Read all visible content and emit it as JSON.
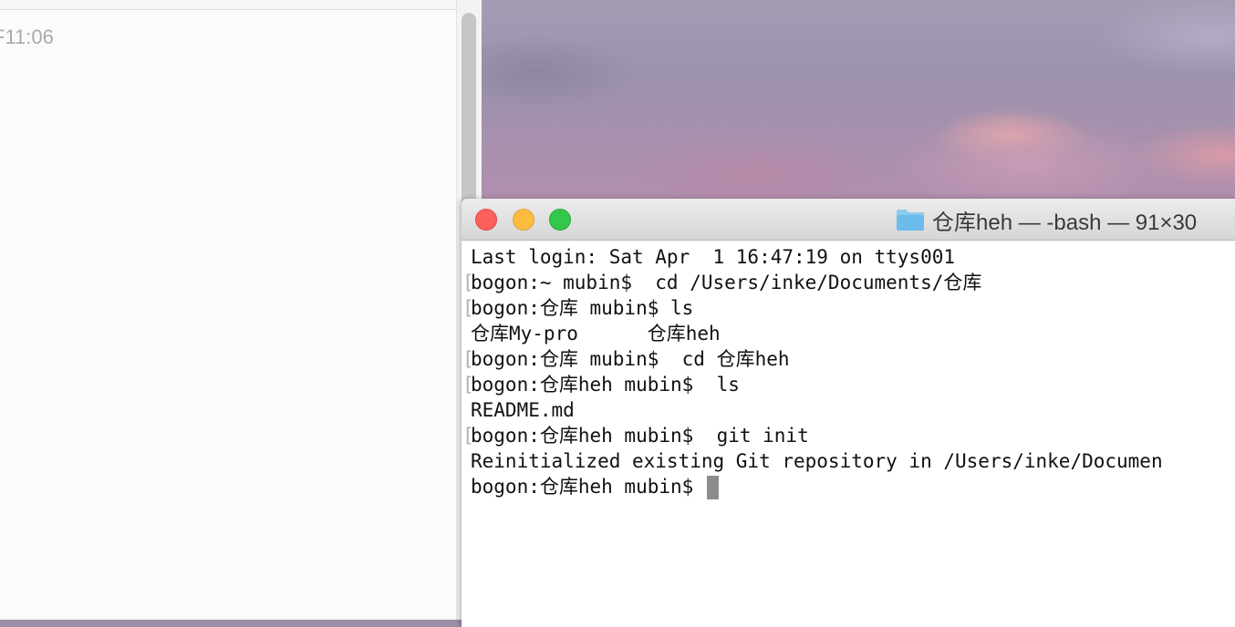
{
  "notes": {
    "time_fragment": "F11:06"
  },
  "terminal": {
    "title": "仓库heh — -bash — 91×30",
    "lines": [
      {
        "text": "Last login: Sat Apr  1 16:47:19 on ttys001",
        "marked": false
      },
      {
        "text": "bogon:~ mubin$  cd /Users/inke/Documents/仓库",
        "marked": true
      },
      {
        "text": "bogon:仓库 mubin$ ls",
        "marked": true
      },
      {
        "text": "仓库My-pro      仓库heh",
        "marked": false
      },
      {
        "text": "bogon:仓库 mubin$  cd 仓库heh",
        "marked": true
      },
      {
        "text": "bogon:仓库heh mubin$  ls",
        "marked": true
      },
      {
        "text": "README.md",
        "marked": false
      },
      {
        "text": "bogon:仓库heh mubin$  git init",
        "marked": true
      },
      {
        "text": "Reinitialized existing Git repository in /Users/inke/Documen",
        "marked": false
      },
      {
        "text": "bogon:仓库heh mubin$ ",
        "marked": false
      }
    ],
    "icons": {
      "folder": "folder-icon",
      "close": "close-button",
      "minimize": "minimize-button",
      "zoom": "zoom-button"
    },
    "colors": {
      "close": "#fc605b",
      "minimize": "#fdbc40",
      "zoom": "#34c84a",
      "folder": "#7cc3ee"
    }
  }
}
